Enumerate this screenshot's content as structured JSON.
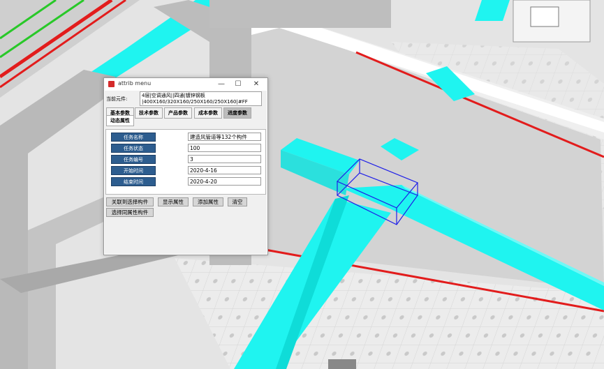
{
  "window": {
    "title": "attrib menu",
    "minimize_glyph": "—",
    "maximize_glyph": "☐",
    "close_glyph": "✕"
  },
  "current_element": {
    "label": "当前元件:",
    "value_line1": "4层|空调通风||四通|镀锌钢板",
    "value_line2": "|400X160/320X160/250X160/250X160|#FF"
  },
  "tabs": [
    {
      "label": "基本参数"
    },
    {
      "label": "技术参数"
    },
    {
      "label": "产品参数"
    },
    {
      "label": "成本参数"
    },
    {
      "label": "进度参数"
    },
    {
      "label": "动态属性"
    }
  ],
  "fields": [
    {
      "label": "任务名称",
      "value": "建造风管道等132个构件"
    },
    {
      "label": "任务状态",
      "value": "100"
    },
    {
      "label": "任务编号",
      "value": "3"
    },
    {
      "label": "开始时间",
      "value": "2020-4-16"
    },
    {
      "label": "结束时间",
      "value": "2020-4-20"
    }
  ],
  "buttons": {
    "link_selected": "关联到选择构件",
    "show_props": "显示属性",
    "add_prop": "添加属性",
    "clear": "清空",
    "select_same": "选择同属性构件"
  },
  "colors": {
    "duct_cyan": "#1ff4f0",
    "wall_gray": "#bdbdbd",
    "pipe_red": "#e21c1c",
    "pipe_green": "#28c828",
    "selection_blue": "#1e1ee8",
    "label_blue": "#2d5d8f"
  }
}
